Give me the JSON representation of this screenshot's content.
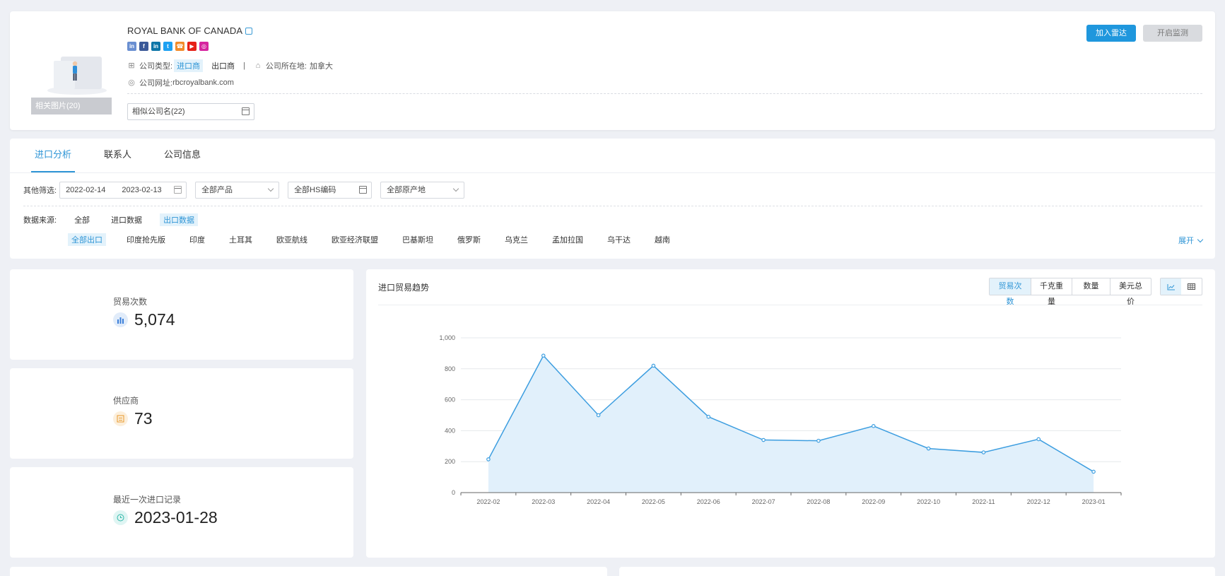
{
  "company": {
    "name": "ROYAL BANK OF CANADA",
    "photo_caption": "相关图片(20)",
    "socials": [
      {
        "icon": "sns-icon",
        "letter": "in",
        "color": "#6a8fd1"
      },
      {
        "icon": "facebook-icon",
        "letter": "f",
        "color": "#3b5998"
      },
      {
        "icon": "linkedin-icon",
        "letter": "in",
        "color": "#0e76a8"
      },
      {
        "icon": "twitter-icon",
        "letter": "t",
        "color": "#1da1f2"
      },
      {
        "icon": "phone-icon",
        "letter": "☎",
        "color": "#f28b2a"
      },
      {
        "icon": "youtube-icon",
        "letter": "▶",
        "color": "#e62117"
      },
      {
        "icon": "instagram-icon",
        "letter": "◎",
        "color": "#d6249f"
      }
    ],
    "type_label": "公司类型:",
    "type_importer": "进口商",
    "type_exporter": "出口商",
    "separator": "|",
    "location_label": "公司所在地:",
    "location_value": "加拿大",
    "website_label": "公司网址:",
    "website_value": "rbcroyalbank.com",
    "similar_names": "相似公司名(22)",
    "btn_radar": "加入雷达",
    "btn_monitor": "开启监测"
  },
  "tabs": [
    "进口分析",
    "联系人",
    "公司信息"
  ],
  "filters": {
    "label": "其他筛选:",
    "date_start": "2022-02-14",
    "date_end": "2023-02-13",
    "product": "全部产品",
    "hs_code": "全部HS编码",
    "origin": "全部原产地"
  },
  "source": {
    "label": "数据来源:",
    "options": [
      "全部",
      "进口数据",
      "出口数据"
    ]
  },
  "regions": [
    "全部出口",
    "印度抢先版",
    "印度",
    "土耳其",
    "欧亚航线",
    "欧亚经济联盟",
    "巴基斯坦",
    "俄罗斯",
    "乌克兰",
    "孟加拉国",
    "乌干达",
    "越南"
  ],
  "expand_label": "展开",
  "stats": {
    "trades_label": "贸易次数",
    "trades_value": "5,074",
    "suppliers_label": "供应商",
    "suppliers_value": "73",
    "last_label": "最近一次进口记录",
    "last_value": "2023-01-28"
  },
  "chart_panel": {
    "title": "进口贸易趋势",
    "metrics": [
      "贸易次数",
      "千克重量",
      "数量",
      "美元总价"
    ]
  },
  "colors": {
    "accent": "#2f95d6",
    "line": "#3d9ee0",
    "area": "#e1f0fb"
  },
  "chart_data": {
    "type": "area",
    "x": [
      "2022-02",
      "2022-03",
      "2022-04",
      "2022-05",
      "2022-06",
      "2022-07",
      "2022-08",
      "2022-09",
      "2022-10",
      "2022-11",
      "2022-12",
      "2023-01"
    ],
    "values": [
      215,
      885,
      500,
      820,
      490,
      340,
      335,
      430,
      285,
      260,
      345,
      135
    ],
    "ylim": [
      0,
      1000
    ],
    "yticks": [
      0,
      200,
      400,
      600,
      800,
      1000
    ],
    "ytick_labels": [
      "0",
      "200",
      "400",
      "600",
      "800",
      "1,000"
    ],
    "grid": true
  }
}
